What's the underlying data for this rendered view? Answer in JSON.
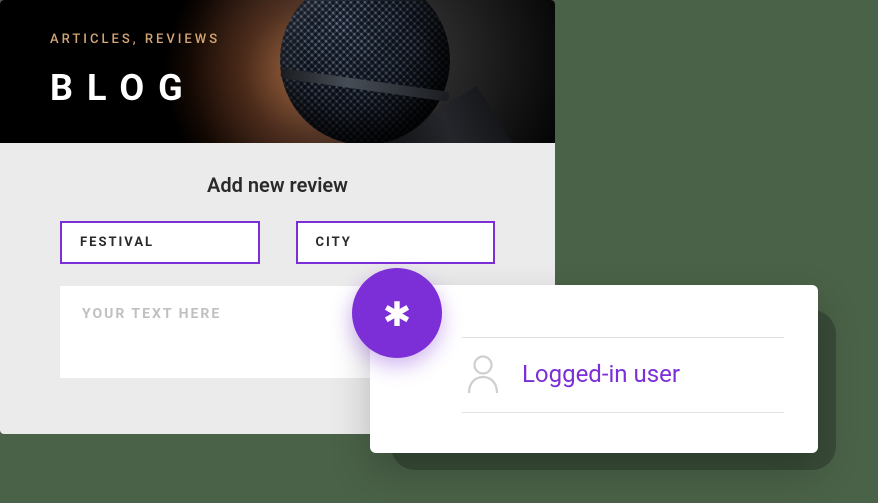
{
  "hero": {
    "subtitle": "ARTICLES, REVIEWS",
    "title": "BLOG"
  },
  "form": {
    "heading": "Add new review",
    "festival_label": "FESTIVAL",
    "city_label": "CITY",
    "textarea_placeholder": "YOUR TEXT HERE"
  },
  "fab": {
    "glyph": "✱"
  },
  "popup": {
    "label": "Logged-in user"
  },
  "colors": {
    "accent": "#7c2fd6",
    "hero_accent": "#d4a574"
  }
}
